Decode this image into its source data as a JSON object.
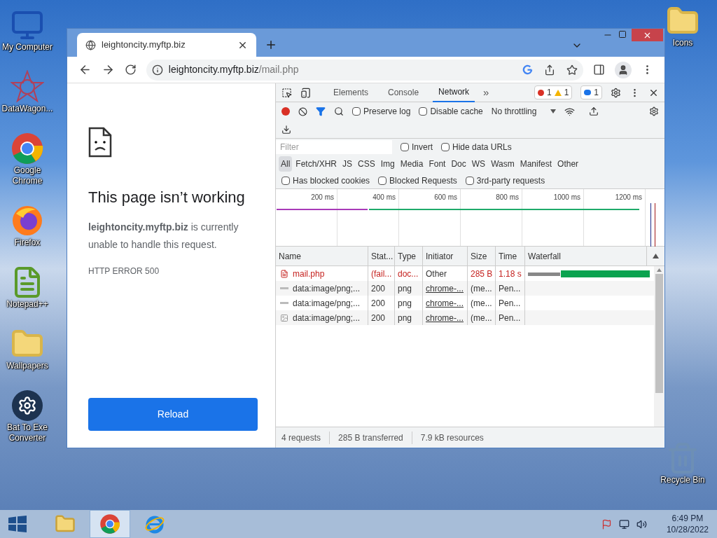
{
  "desktop_icons": [
    {
      "label": "My Computer",
      "kind": "computer"
    },
    {
      "label": "DataWagon...",
      "kind": "star"
    },
    {
      "label": "Google Chrome",
      "kind": "chrome"
    },
    {
      "label": "Firefox",
      "kind": "firefox"
    },
    {
      "label": "Notepad++",
      "kind": "notepad"
    },
    {
      "label": "Wallpapers",
      "kind": "folder"
    },
    {
      "label": "Bat To Exe Converter",
      "kind": "gear"
    }
  ],
  "right_icons": [
    {
      "label": "Icons",
      "kind": "folder"
    },
    {
      "label": "Recycle Bin",
      "kind": "bin"
    }
  ],
  "browser": {
    "tab_title": "leightoncity.myftp.biz",
    "address_host": "leightoncity.myftp.biz",
    "address_path": "/mail.php"
  },
  "page": {
    "title": "This page isn’t working",
    "message": "**leightoncity.myftp.biz** is currently unable to handle this request.",
    "error_code": "HTTP ERROR 500",
    "reload_button": "Reload"
  },
  "devtools": {
    "tabs": [
      {
        "label": "Elements",
        "selected": false
      },
      {
        "label": "Console",
        "selected": false
      },
      {
        "label": "Network",
        "selected": true
      }
    ],
    "more": "»",
    "errors": "1",
    "warnings": "1",
    "messages": "1",
    "preserve_log": {
      "label": "Preserve log",
      "checked": false
    },
    "disable_cache": {
      "label": "Disable cache",
      "checked": false
    },
    "throttling": "No throttling",
    "filter_placeholder": "Filter",
    "filter_checks": [
      {
        "label": "Invert",
        "checked": false
      },
      {
        "label": "Hide data URLs",
        "checked": false
      }
    ],
    "type_filters": [
      {
        "label": "All",
        "selected": true
      },
      {
        "label": "Fetch/XHR",
        "selected": false
      },
      {
        "label": "JS",
        "selected": false
      },
      {
        "label": "CSS",
        "selected": false
      },
      {
        "label": "Img",
        "selected": false
      },
      {
        "label": "Media",
        "selected": false
      },
      {
        "label": "Font",
        "selected": false
      },
      {
        "label": "Doc",
        "selected": false
      },
      {
        "label": "WS",
        "selected": false
      },
      {
        "label": "Wasm",
        "selected": false
      },
      {
        "label": "Manifest",
        "selected": false
      },
      {
        "label": "Other",
        "selected": false
      }
    ],
    "request_checks": [
      {
        "label": "Has blocked cookies",
        "checked": false
      },
      {
        "label": "Blocked Requests",
        "checked": false
      },
      {
        "label": "3rd-party requests",
        "checked": false
      }
    ],
    "timeline_ticks": [
      "200 ms",
      "400 ms",
      "600 ms",
      "800 ms",
      "1000 ms",
      "1200 ms"
    ],
    "columns": [
      "Name",
      "Stat...",
      "Type",
      "Initiator",
      "Size",
      "Time",
      "Waterfall"
    ],
    "rows": [
      {
        "kind": "document",
        "failed": true,
        "name": "mail.php",
        "status": "(fail...",
        "type": "doc...",
        "initiator": "Other",
        "size": "285 B",
        "time": "1.18 s"
      },
      {
        "kind": "data",
        "failed": false,
        "name": "data:image/png;...",
        "status": "200",
        "type": "png",
        "initiator": "chrome-...",
        "size": "(me...",
        "time": "Pen..."
      },
      {
        "kind": "data",
        "failed": false,
        "name": "data:image/png;...",
        "status": "200",
        "type": "png",
        "initiator": "chrome-...",
        "size": "(me...",
        "time": "Pen..."
      },
      {
        "kind": "image",
        "failed": false,
        "name": "data:image/png;...",
        "status": "200",
        "type": "png",
        "initiator": "chrome-...",
        "size": "(me...",
        "time": "Pen..."
      }
    ],
    "status_bar": [
      "4 requests",
      "285 B transferred",
      "7.9 kB resources"
    ]
  },
  "taskbar": {
    "apps": [
      {
        "kind": "folder",
        "selected": false
      },
      {
        "kind": "chrome",
        "selected": true
      },
      {
        "kind": "ie",
        "selected": false
      }
    ],
    "time": "6:49 PM",
    "date": "10/28/2022"
  }
}
